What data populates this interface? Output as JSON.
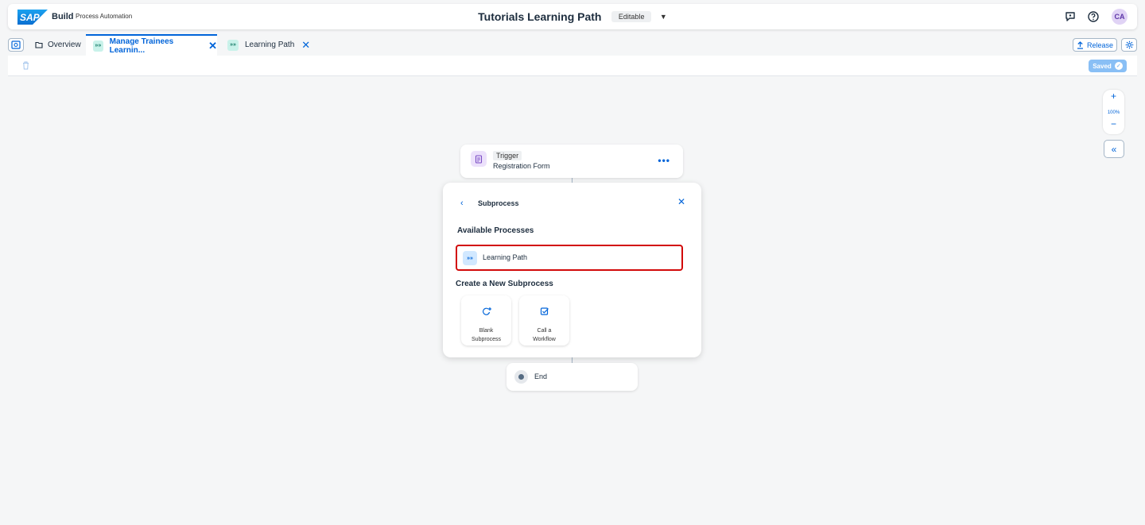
{
  "shell": {
    "logo_text": "SAP",
    "brand": "Build",
    "product": "Process Automation",
    "project_title": "Tutorials Learning Path",
    "status_badge": "Editable",
    "avatar_initials": "CA",
    "icons": [
      "sap-logo",
      "caret-down-icon",
      "chat-icon",
      "help-icon"
    ]
  },
  "tabs": [
    {
      "label": "Overview",
      "icon": "folder-icon",
      "active": false,
      "closable": false
    },
    {
      "label": "Manage Trainees Learnin...",
      "icon": "process-icon",
      "active": true,
      "closable": true
    },
    {
      "label": "Learning Path",
      "icon": "process-icon",
      "active": false,
      "closable": true
    }
  ],
  "toolbar": {
    "release_label": "Release",
    "saved_label": "Saved"
  },
  "zoom": {
    "level": "100%"
  },
  "flow": {
    "trigger": {
      "chip": "Trigger",
      "name": "Registration Form"
    },
    "end": {
      "label": "End"
    }
  },
  "popover": {
    "title": "Subprocess",
    "available_heading": "Available Processes",
    "available_items": [
      {
        "label": "Learning Path",
        "icon": "process-icon"
      }
    ],
    "create_heading": "Create a New Subprocess",
    "tiles": [
      {
        "line1": "Blank",
        "line2": "Subprocess",
        "icon": "blank-subprocess-icon"
      },
      {
        "line1": "Call a",
        "line2": "Workflow",
        "icon": "call-workflow-icon"
      }
    ]
  },
  "colors": {
    "accent": "#0064d9",
    "highlight_border": "#d20a0a",
    "saved_bg": "#89bff5",
    "canvas_bg": "#f5f6f7"
  }
}
